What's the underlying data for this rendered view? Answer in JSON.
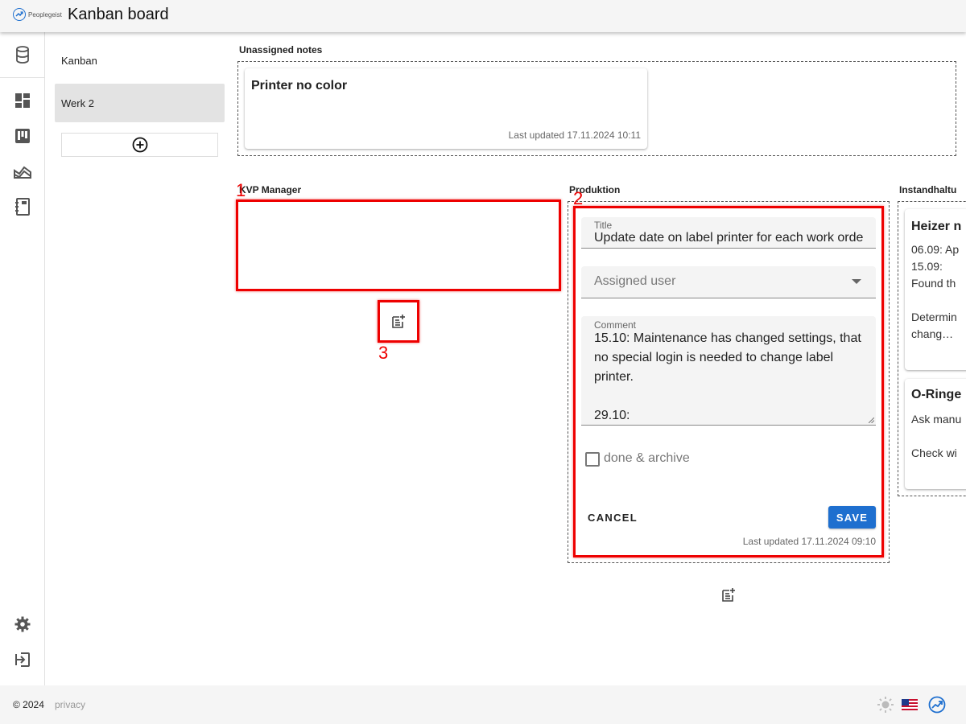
{
  "header": {
    "logo_text": "Peoplegeist",
    "title": "Kanban board"
  },
  "sidebar": {
    "icons": [
      "database-icon",
      "dashboard-icon",
      "kanban-icon",
      "landscape-chart-icon",
      "notebook-icon"
    ],
    "bottom_icons": [
      "settings-icon",
      "logout-icon"
    ]
  },
  "boards": {
    "items": [
      {
        "label": "Kanban",
        "active": false
      },
      {
        "label": "Werk 2",
        "active": true
      }
    ]
  },
  "unassigned": {
    "label": "Unassigned notes",
    "cards": [
      {
        "title": "Printer no color",
        "updated": "Last updated 17.11.2024 10:11"
      }
    ]
  },
  "columns": {
    "kvp": {
      "label": "KVP Manager"
    },
    "produktion": {
      "label": "Produktion",
      "form": {
        "title_label": "Title",
        "title_value": "Update date on label printer for each work order",
        "assigned_placeholder": "Assigned user",
        "comment_label": "Comment",
        "comment_value": "15.10: Maintenance has changed settings, that no special login is needed to change label printer.\n\n29.10:",
        "checkbox_label": "done & archive",
        "cancel_label": "CANCEL",
        "save_label": "SAVE",
        "updated": "Last updated 17.11.2024 09:10"
      }
    },
    "instandhaltung": {
      "label": "Instandhaltu",
      "cards": [
        {
          "title": "Heizer n",
          "lines": [
            "06.09: Ap",
            "15.09:",
            "Found th",
            "",
            "Determin",
            "chang…"
          ]
        },
        {
          "title": "O-Ringe",
          "lines": [
            "Ask manu",
            "",
            "Check wi"
          ]
        }
      ]
    }
  },
  "annotations": {
    "one": "1",
    "two": "2",
    "three": "3"
  },
  "footer": {
    "copyright": "© 2024",
    "privacy": "privacy"
  },
  "colors": {
    "accent": "#1e6fcf",
    "annotation": "#e00000"
  }
}
